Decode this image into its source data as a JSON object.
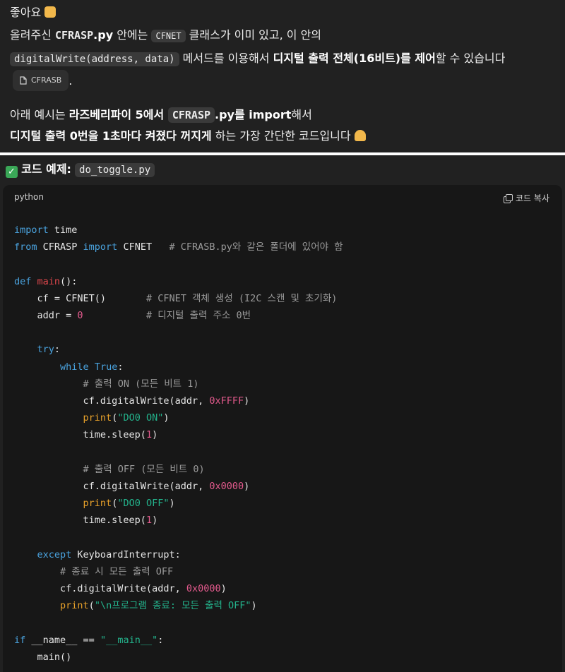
{
  "message": {
    "line1_text": "좋아요",
    "line1_emoji": "thumbs-up-icon",
    "line2_pre": "올려주신 ",
    "line2_file": "CFRASP",
    "line2_ext": ".py",
    "line2_mid": " 안에는 ",
    "line2_class": "CFNET",
    "line2_post": " 클래스가 이미 있고, 이 안의",
    "line3_method": "digitalWrite(address, data)",
    "line3_mid": " 메서드를 이용해서 ",
    "line3_bold": "디지털 출력 전체(16비트)를 제어",
    "line3_post": "할 수 있습니다",
    "file_chip": "CFRASB",
    "line4_pre": "아래 예시는 ",
    "line4_bold1": "라즈베리파이 5에서 ",
    "line4_code": "CFRASP",
    "line4_bold2": ".py를 import",
    "line4_post": "해서",
    "line5_bold": "디지털 출력 0번을 1초마다 켜졌다 꺼지게",
    "line5_post": " 하는 가장 간단한 코드입니다"
  },
  "section": {
    "label": "코드 예제:",
    "filename": "do_toggle.py"
  },
  "codeblock": {
    "language": "python",
    "copy_label": "코드 복사",
    "lines": [
      "import time",
      "from CFRASP import CFNET   # CFRASB.py와 같은 폴더에 있어야 함",
      "",
      "def main():",
      "    cf = CFNET()       # CFNET 객체 생성 (I2C 스캔 및 초기화)",
      "    addr = 0           # 디지털 출력 주소 0번",
      "",
      "    try:",
      "        while True:",
      "            # 출력 ON (모든 비트 1)",
      "            cf.digitalWrite(addr, 0xFFFF)",
      "            print(\"DO0 ON\")",
      "            time.sleep(1)",
      "",
      "            # 출력 OFF (모든 비트 0)",
      "            cf.digitalWrite(addr, 0x0000)",
      "            print(\"DO0 OFF\")",
      "            time.sleep(1)",
      "",
      "    except KeyboardInterrupt:",
      "        # 종료 시 모든 출력 OFF",
      "        cf.digitalWrite(addr, 0x0000)",
      "        print(\"\\n프로그램 종료: 모든 출력 OFF\")",
      "",
      "if __name__ == \"__main__\":",
      "    main()"
    ]
  },
  "colors": {
    "background": "#212121",
    "code_background": "#171717",
    "keyword": "#4aa3df",
    "function": "#e0474c",
    "string": "#23b38c",
    "number": "#e35a8d",
    "comment": "#9a9a9a",
    "builtin": "#e8a12a"
  }
}
